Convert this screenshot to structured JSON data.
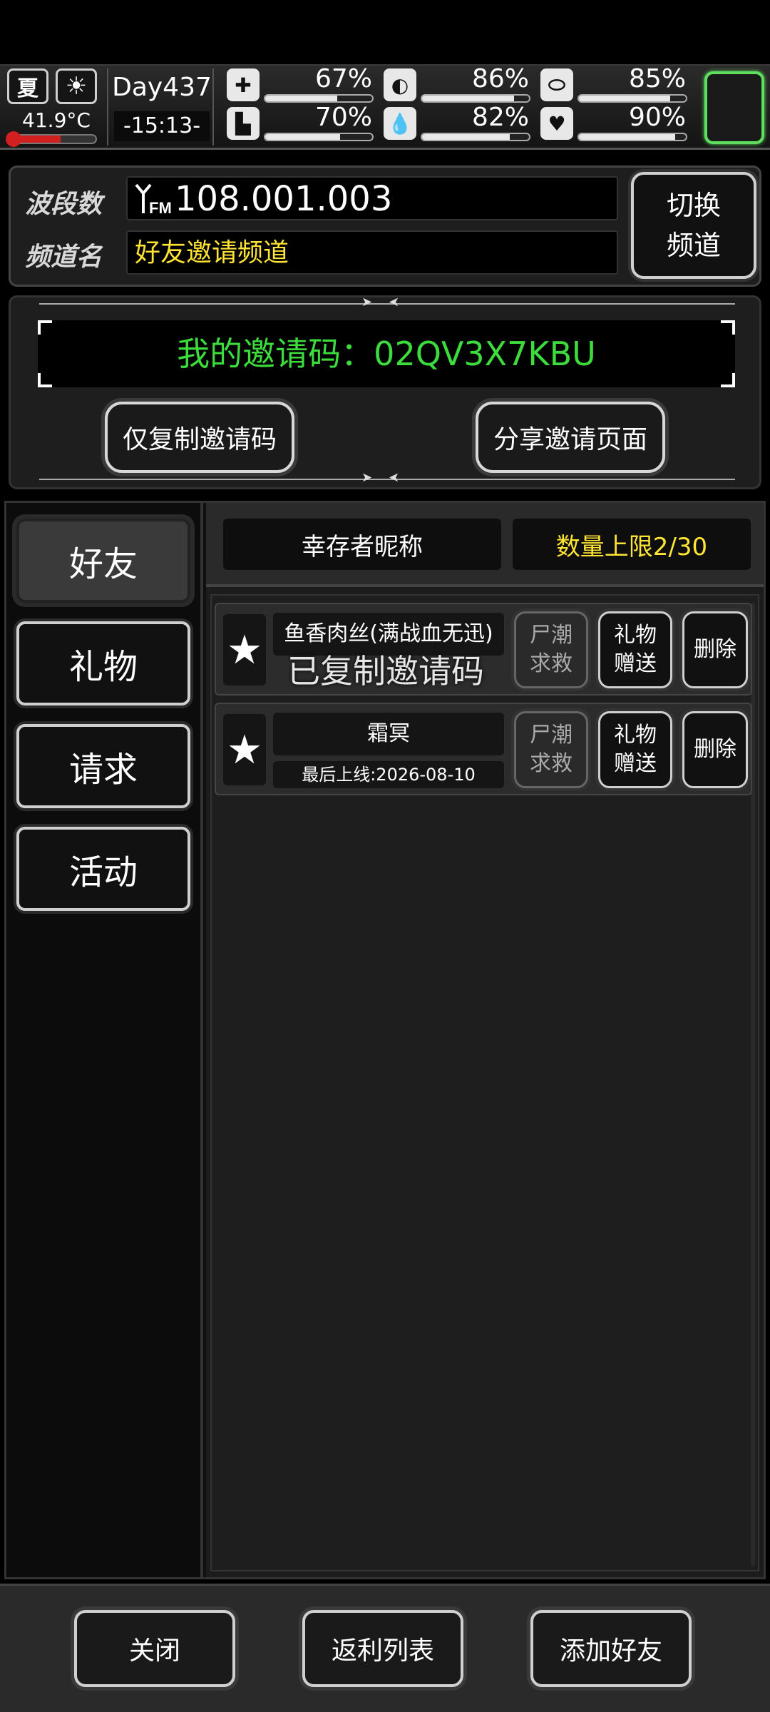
{
  "status": {
    "season": "夏",
    "temperature": "41.9°C",
    "temperature_level": 0.6,
    "day": "Day437",
    "time": "-15:13-",
    "stats": [
      {
        "icon": "medkit-icon",
        "glyph": "✚",
        "pct": "67%",
        "value": 67
      },
      {
        "icon": "stomach-icon",
        "glyph": "◐",
        "pct": "86%",
        "value": 86
      },
      {
        "icon": "pill-icon",
        "glyph": "⬭",
        "pct": "85%",
        "value": 85
      },
      {
        "icon": "foot-icon",
        "glyph": "▙",
        "pct": "70%",
        "value": 70
      },
      {
        "icon": "water-drop-icon",
        "glyph": "💧",
        "pct": "82%",
        "value": 82
      },
      {
        "icon": "heart-icon",
        "glyph": "♥",
        "pct": "90%",
        "value": 90
      }
    ]
  },
  "radio": {
    "band_label": "波段数",
    "frequency": "108.001.003",
    "fm_label": "FM",
    "channel_label": "频道名",
    "channel_name": "好友邀请频道",
    "switch_line1": "切换",
    "switch_line2": "频道"
  },
  "invite": {
    "code_text": "我的邀请码：02QV3X7KBU",
    "copy_button": "仅复制邀请码",
    "share_button": "分享邀请页面"
  },
  "tabs": [
    {
      "label": "好友",
      "active": true
    },
    {
      "label": "礼物",
      "active": false
    },
    {
      "label": "请求",
      "active": false
    },
    {
      "label": "活动",
      "active": false
    }
  ],
  "friends_header": {
    "nickname_col": "幸存者昵称",
    "limit": "数量上限2/30"
  },
  "friends": [
    {
      "name": "鱼香肉丝(满战血无迅)",
      "subtitle": "",
      "zombie_line1": "尸潮",
      "zombie_line2": "求救",
      "gift_line1": "礼物",
      "gift_line2": "赠送",
      "delete": "删除"
    },
    {
      "name": "霜冥",
      "subtitle": "最后上线:2026-08-10",
      "zombie_line1": "尸潮",
      "zombie_line2": "求救",
      "gift_line1": "礼物",
      "gift_line2": "赠送",
      "delete": "删除"
    }
  ],
  "toast": "已复制邀请码",
  "bottom": {
    "close": "关闭",
    "rebate": "返利列表",
    "add_friend": "添加好友"
  },
  "colors": {
    "invite_code": "#3ddc3d",
    "channel_name": "#ffe433",
    "limit_text": "#ffe433",
    "highlight_slot": "#5ee05e"
  }
}
